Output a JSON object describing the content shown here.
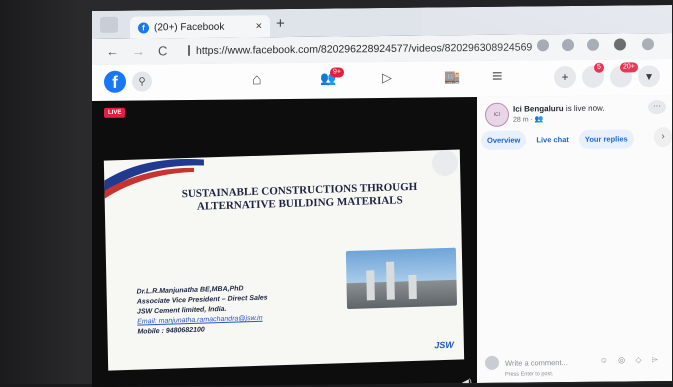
{
  "browser": {
    "tab_title": "(20+) Facebook",
    "tab_close": "×",
    "new_tab": "+",
    "url": "https://www.facebook.com/820296228924577/videos/820296308924569",
    "back": "←",
    "forward": "→",
    "reload": "C"
  },
  "facebook": {
    "logo": "f",
    "search_icon": "⚲",
    "home_icon": "⌂",
    "friends_icon": "👥",
    "friends_badge": "9+",
    "watch_icon": "▷",
    "marketplace_icon": "🏬",
    "menu_icon": "≡",
    "create_icon": "+",
    "messenger_badge": "5",
    "notifications_badge": "20+",
    "account_icon": "▾"
  },
  "video": {
    "live_label": "LIVE",
    "slide_title": "SUSTAINABLE CONSTRUCTIONS THROUGH ALTERNATIVE BUILDING MATERIALS",
    "presenter_lines": [
      "Dr.L.R.Manjunatha BE,MBA,PhD",
      "Associate Vice President – Direct Sales",
      "JSW Cement limited, India.",
      "Email: manjunatha.ramachandra@jsw.in",
      "Mobile : 9480682100"
    ],
    "logo_text": "JSW",
    "volume_icon": "◀)"
  },
  "chat": {
    "avatar_text": "ICI",
    "page_name": "Ici Bengaluru",
    "status_text": "is live now.",
    "time": "28 m · 👥",
    "more": "···",
    "tabs": [
      "Overview",
      "Live chat",
      "Your replies"
    ],
    "arrow": "›",
    "composer_placeholder": "Write a comment...",
    "enter_hint": "Press Enter to post.",
    "composer_icons": "☺ ◎ ◇ ⌲"
  },
  "colors": {
    "fb_blue": "#1877f2",
    "live_red": "#e41e3f"
  }
}
